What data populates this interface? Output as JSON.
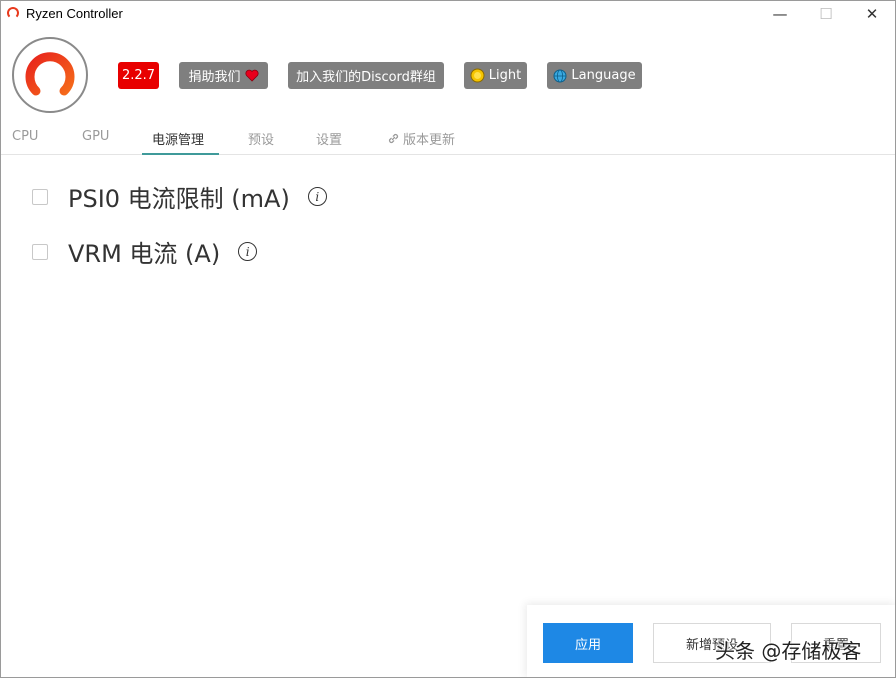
{
  "window": {
    "title": "Ryzen Controller",
    "minimize_glyph": "—",
    "maximize_glyph": "☐",
    "close_glyph": "✕"
  },
  "header": {
    "version": "2.2.7",
    "donate_label": "捐助我们",
    "discord_label": "加入我们的Discord群组",
    "theme_label": "Light",
    "language_label": "Language",
    "icons": {
      "donate": "heart-icon",
      "theme": "sun-icon",
      "language": "globe-icon"
    }
  },
  "tabs": [
    {
      "label": "CPU"
    },
    {
      "label": "GPU"
    },
    {
      "label": "电源管理",
      "active": true
    },
    {
      "label": "预设"
    },
    {
      "label": "设置"
    },
    {
      "label": "版本更新",
      "icon": "link-icon"
    }
  ],
  "options": [
    {
      "label": "PSI0 电流限制 (mA)",
      "checked": false
    },
    {
      "label": "VRM 电流 (A)",
      "checked": false
    }
  ],
  "info_glyph": "i",
  "footer": {
    "apply_label": "应用",
    "new_preset_label": "新增预设",
    "reset_label": "重置"
  },
  "watermark": "头条 @存储极客",
  "colors": {
    "version_badge": "#e80000",
    "header_button": "#7f7f7f",
    "tab_underline": "#3f9a9a",
    "apply_button": "#1e88e5",
    "logo_ring": "#e8391d"
  }
}
